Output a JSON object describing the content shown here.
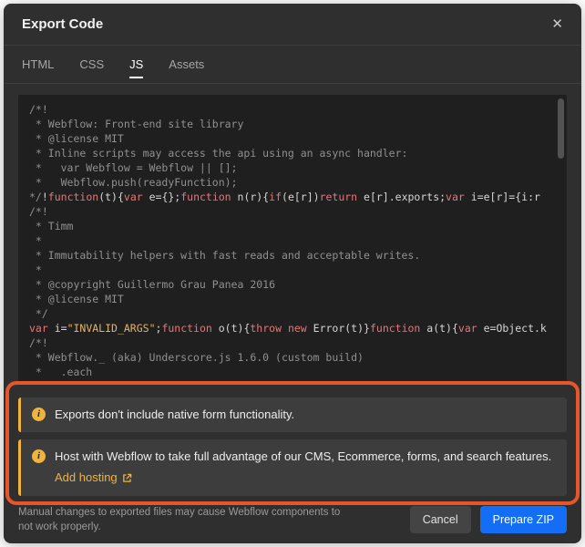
{
  "modal": {
    "title": "Export Code"
  },
  "icons": {
    "close": "✕",
    "info": "i"
  },
  "tabs": [
    {
      "id": "html",
      "label": "HTML",
      "active": false
    },
    {
      "id": "css",
      "label": "CSS",
      "active": false
    },
    {
      "id": "js",
      "label": "JS",
      "active": true
    },
    {
      "id": "assets",
      "label": "Assets",
      "active": false
    }
  ],
  "code_editor": {
    "lines": [
      [
        {
          "t": "/*!",
          "c": "comment"
        }
      ],
      [
        {
          "t": " * Webflow: Front-end site library",
          "c": "comment"
        }
      ],
      [
        {
          "t": " * @license MIT",
          "c": "comment"
        }
      ],
      [
        {
          "t": " * Inline scripts may access the api using an async handler:",
          "c": "comment"
        }
      ],
      [
        {
          "t": " *   var Webflow = Webflow || [];",
          "c": "comment"
        }
      ],
      [
        {
          "t": " *   Webflow.push(readyFunction);",
          "c": "comment"
        }
      ],
      [
        {
          "t": "*/",
          "c": "comment"
        },
        {
          "t": "!",
          "c": "plain"
        },
        {
          "t": "function",
          "c": "kw"
        },
        {
          "t": "(t){",
          "c": "plain"
        },
        {
          "t": "var",
          "c": "kw"
        },
        {
          "t": " e={};",
          "c": "plain"
        },
        {
          "t": "function",
          "c": "kw"
        },
        {
          "t": " n(r){",
          "c": "plain"
        },
        {
          "t": "if",
          "c": "kw"
        },
        {
          "t": "(e[r])",
          "c": "plain"
        },
        {
          "t": "return",
          "c": "kw"
        },
        {
          "t": " e[r].exports;",
          "c": "plain"
        },
        {
          "t": "var",
          "c": "kw"
        },
        {
          "t": " i=e[r]={i:r",
          "c": "plain"
        }
      ],
      [
        {
          "t": "/*!",
          "c": "comment"
        }
      ],
      [
        {
          "t": " * Timm",
          "c": "comment"
        }
      ],
      [
        {
          "t": " *",
          "c": "comment"
        }
      ],
      [
        {
          "t": " * Immutability helpers with fast reads and acceptable writes.",
          "c": "comment"
        }
      ],
      [
        {
          "t": " *",
          "c": "comment"
        }
      ],
      [
        {
          "t": " * @copyright Guillermo Grau Panea 2016",
          "c": "comment"
        }
      ],
      [
        {
          "t": " * @license MIT",
          "c": "comment"
        }
      ],
      [
        {
          "t": " */",
          "c": "comment"
        }
      ],
      [
        {
          "t": "var",
          "c": "kw"
        },
        {
          "t": " i=",
          "c": "plain"
        },
        {
          "t": "\"INVALID_ARGS\"",
          "c": "str"
        },
        {
          "t": ";",
          "c": "plain"
        },
        {
          "t": "function",
          "c": "kw"
        },
        {
          "t": " o(t){",
          "c": "plain"
        },
        {
          "t": "throw",
          "c": "kw"
        },
        {
          "t": " ",
          "c": "plain"
        },
        {
          "t": "new",
          "c": "kw"
        },
        {
          "t": " Error(t)}",
          "c": "plain"
        },
        {
          "t": "function",
          "c": "kw"
        },
        {
          "t": " a(t){",
          "c": "plain"
        },
        {
          "t": "var",
          "c": "kw"
        },
        {
          "t": " e=Object.k",
          "c": "plain"
        }
      ],
      [
        {
          "t": "/*!",
          "c": "comment"
        }
      ],
      [
        {
          "t": " * Webflow._ (aka) Underscore.js 1.6.0 (custom build)",
          "c": "comment"
        }
      ],
      [
        {
          "t": " *   .each",
          "c": "comment"
        }
      ]
    ]
  },
  "notices": [
    {
      "text": "Exports don't include native form functionality.",
      "link": null
    },
    {
      "text": "Host with Webflow to take full advantage of our CMS, Ecommerce, forms, and search features.",
      "link": "Add hosting"
    }
  ],
  "footer": {
    "warning": "Manual changes to exported files may cause Webflow components to not work properly.",
    "cancel_label": "Cancel",
    "prepare_zip_label": "Prepare ZIP"
  },
  "colors": {
    "accent_blue": "#146ef5",
    "notice_accent": "#f0b43c",
    "annotation": "#e8552a",
    "code_keyword": "#e2777a",
    "code_string": "#e6b36a",
    "code_comment": "#909090"
  }
}
